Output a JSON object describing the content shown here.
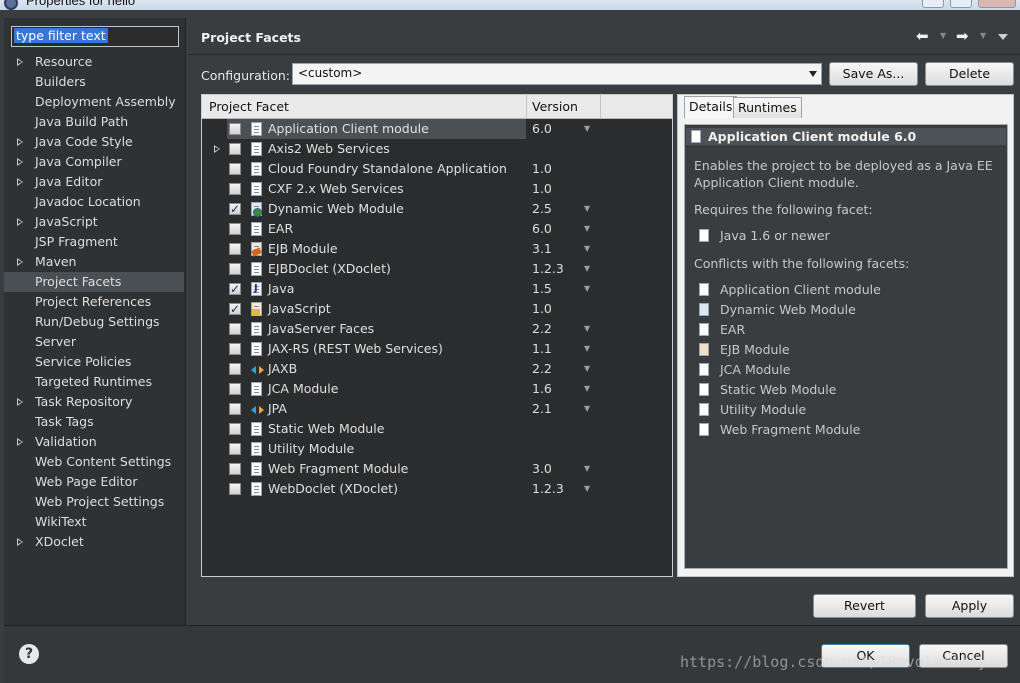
{
  "window": {
    "title": "Properties for hello"
  },
  "left_panel": {
    "filter_value": "type filter text",
    "items": [
      {
        "label": "Resource",
        "expandable": true
      },
      {
        "label": "Builders",
        "expandable": false
      },
      {
        "label": "Deployment Assembly",
        "expandable": false
      },
      {
        "label": "Java Build Path",
        "expandable": false
      },
      {
        "label": "Java Code Style",
        "expandable": true
      },
      {
        "label": "Java Compiler",
        "expandable": true
      },
      {
        "label": "Java Editor",
        "expandable": true
      },
      {
        "label": "Javadoc Location",
        "expandable": false
      },
      {
        "label": "JavaScript",
        "expandable": true
      },
      {
        "label": "JSP Fragment",
        "expandable": false
      },
      {
        "label": "Maven",
        "expandable": true
      },
      {
        "label": "Project Facets",
        "expandable": false,
        "selected": true
      },
      {
        "label": "Project References",
        "expandable": false
      },
      {
        "label": "Run/Debug Settings",
        "expandable": false
      },
      {
        "label": "Server",
        "expandable": false
      },
      {
        "label": "Service Policies",
        "expandable": false
      },
      {
        "label": "Targeted Runtimes",
        "expandable": false
      },
      {
        "label": "Task Repository",
        "expandable": true
      },
      {
        "label": "Task Tags",
        "expandable": false
      },
      {
        "label": "Validation",
        "expandable": true
      },
      {
        "label": "Web Content Settings",
        "expandable": false
      },
      {
        "label": "Web Page Editor",
        "expandable": false
      },
      {
        "label": "Web Project Settings",
        "expandable": false
      },
      {
        "label": "WikiText",
        "expandable": false
      },
      {
        "label": "XDoclet",
        "expandable": true
      }
    ]
  },
  "page": {
    "title": "Project Facets",
    "configuration_label": "Configuration:",
    "configuration_value": "<custom>",
    "save_as_label": "Save As...",
    "delete_label": "Delete",
    "revert_label": "Revert",
    "apply_label": "Apply"
  },
  "facet_table": {
    "col_facet": "Project Facet",
    "col_version": "Version",
    "rows": [
      {
        "name": "Application Client module",
        "version": "6.0",
        "checked": false,
        "icon": "doc",
        "has_drop": true,
        "selected": true,
        "expandable": false
      },
      {
        "name": "Axis2 Web Services",
        "version": "",
        "checked": false,
        "icon": "doc",
        "has_drop": false,
        "expandable": true
      },
      {
        "name": "Cloud Foundry Standalone Application",
        "version": "1.0",
        "checked": false,
        "icon": "doc",
        "has_drop": false,
        "expandable": false
      },
      {
        "name": "CXF 2.x Web Services",
        "version": "1.0",
        "checked": false,
        "icon": "doc",
        "has_drop": false,
        "expandable": false
      },
      {
        "name": "Dynamic Web Module",
        "version": "2.5",
        "checked": true,
        "icon": "web",
        "has_drop": true,
        "expandable": false
      },
      {
        "name": "EAR",
        "version": "6.0",
        "checked": false,
        "icon": "doc",
        "has_drop": true,
        "expandable": false
      },
      {
        "name": "EJB Module",
        "version": "3.1",
        "checked": false,
        "icon": "ejb",
        "has_drop": true,
        "expandable": false
      },
      {
        "name": "EJBDoclet (XDoclet)",
        "version": "1.2.3",
        "checked": false,
        "icon": "doc",
        "has_drop": true,
        "expandable": false
      },
      {
        "name": "Java",
        "version": "1.5",
        "checked": true,
        "icon": "java",
        "has_drop": true,
        "expandable": false
      },
      {
        "name": "JavaScript",
        "version": "1.0",
        "checked": true,
        "icon": "js",
        "has_drop": false,
        "expandable": false
      },
      {
        "name": "JavaServer Faces",
        "version": "2.2",
        "checked": false,
        "icon": "doc",
        "has_drop": true,
        "expandable": false
      },
      {
        "name": "JAX-RS (REST Web Services)",
        "version": "1.1",
        "checked": false,
        "icon": "doc",
        "has_drop": true,
        "expandable": false
      },
      {
        "name": "JAXB",
        "version": "2.2",
        "checked": false,
        "icon": "xml",
        "has_drop": true,
        "expandable": false
      },
      {
        "name": "JCA Module",
        "version": "1.6",
        "checked": false,
        "icon": "doc",
        "has_drop": true,
        "expandable": false
      },
      {
        "name": "JPA",
        "version": "2.1",
        "checked": false,
        "icon": "xml",
        "has_drop": true,
        "expandable": false
      },
      {
        "name": "Static Web Module",
        "version": "",
        "checked": false,
        "icon": "doc",
        "has_drop": false,
        "expandable": false
      },
      {
        "name": "Utility Module",
        "version": "",
        "checked": false,
        "icon": "doc",
        "has_drop": false,
        "expandable": false
      },
      {
        "name": "Web Fragment Module",
        "version": "3.0",
        "checked": false,
        "icon": "doc",
        "has_drop": true,
        "expandable": false
      },
      {
        "name": "WebDoclet (XDoclet)",
        "version": "1.2.3",
        "checked": false,
        "icon": "doc",
        "has_drop": true,
        "expandable": false
      }
    ]
  },
  "details": {
    "tab_details": "Details",
    "tab_runtimes": "Runtimes",
    "title": "Application Client module 6.0",
    "description_1": "Enables the project to be deployed as a Java EE",
    "description_2": "Application Client module.",
    "requires_label": "Requires the following facet:",
    "requires_item": "Java 1.6 or newer",
    "conflicts_label": "Conflicts with the following facets:",
    "conflicts": [
      "Application Client module",
      "Dynamic Web Module",
      "EAR",
      "EJB Module",
      "JCA Module",
      "Static Web Module",
      "Utility Module",
      "Web Fragment Module"
    ]
  },
  "dialog": {
    "ok_label": "OK",
    "cancel_label": "Cancel",
    "watermark": "https://blog.csdn.net/IRevolutioty"
  }
}
